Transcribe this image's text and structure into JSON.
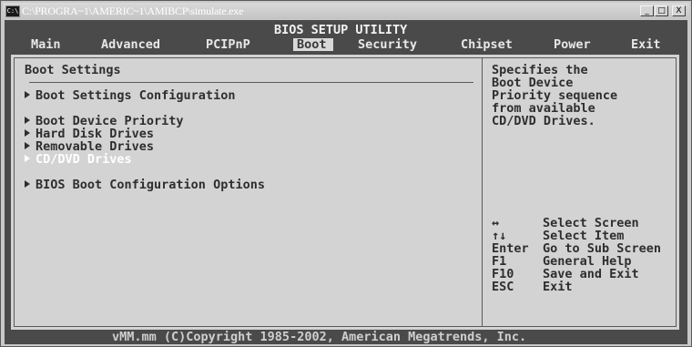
{
  "window": {
    "title": "C:\\PROGRA~1\\AMERIC~1\\AMIBCP\\simulate.exe",
    "icon": "C:\\",
    "controls": [
      "_",
      "□",
      "X"
    ]
  },
  "bios": {
    "utility_title": "BIOS SETUP UTILITY",
    "tabs": [
      "Main",
      "Advanced",
      "PCIPnP",
      "Boot",
      "Security",
      "Chipset",
      "Power",
      "Exit"
    ],
    "active_tab": "Boot"
  },
  "main": {
    "section_title": "Boot Settings",
    "items": [
      "Boot Settings Configuration",
      "Boot Device Priority",
      "Hard Disk Drives",
      "Removable Drives",
      "CD/DVD Drives",
      "BIOS Boot Configuration Options"
    ],
    "selected_item": "CD/DVD Drives"
  },
  "help": {
    "lines": [
      "Specifies the",
      "Boot Device",
      "Priority sequence",
      "from available",
      "CD/DVD Drives."
    ],
    "keys": [
      {
        "key": "↔",
        "action": "Select Screen"
      },
      {
        "key": "↑↓",
        "action": "Select Item"
      },
      {
        "key": "Enter",
        "action": "Go to Sub Screen"
      },
      {
        "key": "F1",
        "action": "General Help"
      },
      {
        "key": "F10",
        "action": "Save and Exit"
      },
      {
        "key": "ESC",
        "action": "Exit"
      }
    ]
  },
  "footer": {
    "copyright": "vMM.mm (C)Copyright 1985-2002, American Megatrends, Inc."
  },
  "colors": {
    "screen_bg": "#4a4a4a",
    "panel_bg": "#d3d3d3",
    "selected_text": "#ffffff"
  }
}
